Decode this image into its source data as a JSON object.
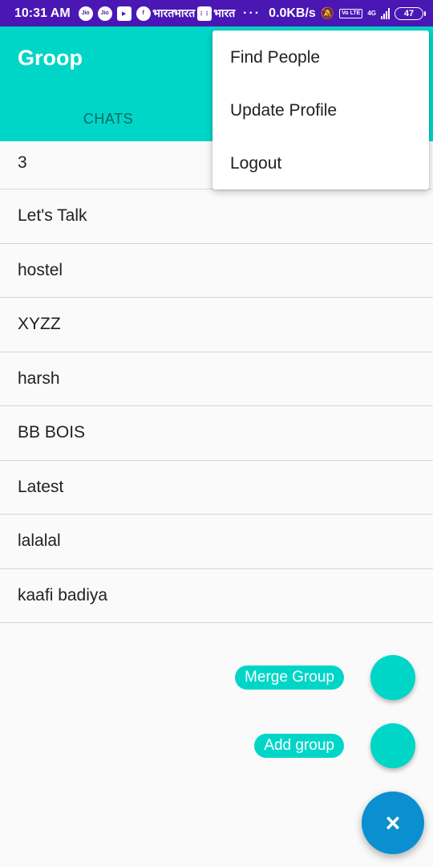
{
  "status_bar": {
    "time": "10:31 AM",
    "left_icons": [
      "Jio",
      "Jio",
      "▶",
      "f",
      "भारत",
      "भारत",
      "⋮⋮",
      "भारत"
    ],
    "dots": "···",
    "net_speed": "0.0KB/s",
    "bell_icon": "🔕",
    "volte": "Vo LTE",
    "network": "4G",
    "battery": "47"
  },
  "app_bar": {
    "title": "Groop",
    "tab_chats": "CHATS"
  },
  "colors": {
    "status_bar": "#4a17b5",
    "primary": "#00d6c8",
    "fab": "#0a8fd0"
  },
  "chats": [
    {
      "name": "3"
    },
    {
      "name": "Let's Talk"
    },
    {
      "name": "hostel"
    },
    {
      "name": "XYZZ"
    },
    {
      "name": "harsh"
    },
    {
      "name": "BB BOIS"
    },
    {
      "name": "Latest"
    },
    {
      "name": "lalalal"
    },
    {
      "name": "kaafi badiya"
    }
  ],
  "overflow_menu": {
    "items": [
      "Find People",
      "Update Profile",
      "Logout"
    ]
  },
  "fab_menu": {
    "merge_label": "Merge Group",
    "add_label": "Add group",
    "close_icon": "×"
  }
}
